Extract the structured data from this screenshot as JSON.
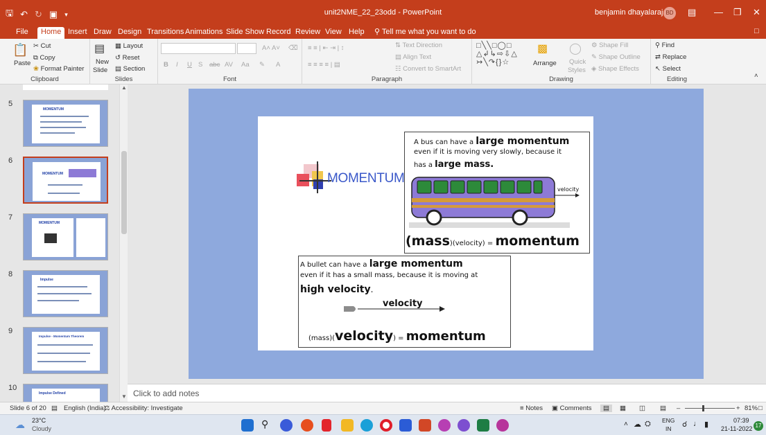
{
  "window": {
    "doc_title": "unit2NME_22_23odd - PowerPoint",
    "user_name": "benjamin dhayalarajan",
    "user_initials": "BD",
    "qat_icons": [
      "save-icon",
      "undo-icon",
      "redo-icon",
      "present-icon"
    ]
  },
  "menu": {
    "tabs": [
      "File",
      "Home",
      "Insert",
      "Draw",
      "Design",
      "Transitions",
      "Animations",
      "Slide Show",
      "Record",
      "Review",
      "View",
      "Help"
    ],
    "active": "Home",
    "tell_me": "Tell me what you want to do"
  },
  "ribbon": {
    "clipboard": {
      "label": "Clipboard",
      "paste": "Paste",
      "cut": "Cut",
      "copy": "Copy",
      "format_painter": "Format Painter"
    },
    "slides": {
      "label": "Slides",
      "new_slide": "New",
      "new_slide2": "Slide",
      "layout": "Layout",
      "reset": "Reset",
      "section": "Section"
    },
    "font": {
      "label": "Font",
      "bold": "B",
      "italic": "I",
      "underline": "U",
      "strike": "S",
      "abc": "abc",
      "av": "AV",
      "aa": "Aa",
      "a": "A"
    },
    "paragraph": {
      "label": "Paragraph",
      "text_direction": "Text Direction",
      "align_text": "Align Text",
      "convert": "Convert to SmartArt"
    },
    "drawing": {
      "label": "Drawing",
      "arrange": "Arrange",
      "quick": "Quick",
      "styles": "Styles",
      "shape_fill": "Shape Fill",
      "shape_outline": "Shape Outline",
      "shape_effects": "Shape Effects"
    },
    "editing": {
      "label": "Editing",
      "find": "Find",
      "replace": "Replace",
      "select": "Select"
    }
  },
  "thumbnails": [
    {
      "num": "5",
      "title": "MOMENTUM"
    },
    {
      "num": "6",
      "title": "MOMENTUM"
    },
    {
      "num": "7",
      "title": "MOMENTUM"
    },
    {
      "num": "8",
      "title": "Impulse"
    },
    {
      "num": "9",
      "title": "Impulse - Momentum Theorem"
    },
    {
      "num": "10",
      "title": "Impulse Defined"
    }
  ],
  "slide": {
    "title": "MOMENTUM",
    "bus": {
      "line1_pre": "A bus can have a ",
      "line1_big": "large momentum",
      "line2": "even if it is moving very slowly, because it",
      "line3_pre": "has a ",
      "line3_big": "large mass.",
      "velocity_label": "velocity",
      "formula_mass": "(mass",
      "formula_vel": ")(velocity) = ",
      "formula_mom": "momentum"
    },
    "bullet": {
      "line1_pre": "A bullet can have a ",
      "line1_big": "large momentum",
      "line2": "even if it has a small mass, because it is moving at",
      "line3_big": "high velocity",
      "line3_post": ".",
      "velocity_label": "velocity",
      "formula_mass": "(mass)(",
      "formula_vel": "velocity",
      "formula_eq": ") = ",
      "formula_mom": "momentum"
    }
  },
  "notes": {
    "placeholder": "Click to add notes"
  },
  "status": {
    "slide": "Slide 6 of 20",
    "language": "English (India)",
    "accessibility": "Accessibility: Investigate",
    "notes": "Notes",
    "comments": "Comments",
    "zoom": "81%"
  },
  "taskbar": {
    "temp": "23°C",
    "weather": "Cloudy",
    "lang1": "ENG",
    "lang2": "IN",
    "time": "07:39",
    "date": "21-11-2022",
    "badge": "17"
  },
  "colors": {
    "accent": "#c43e1c",
    "slide_bg": "#8ea9dd",
    "title_blue": "#3a58c9",
    "bus_purple": "#8d7ad6"
  }
}
